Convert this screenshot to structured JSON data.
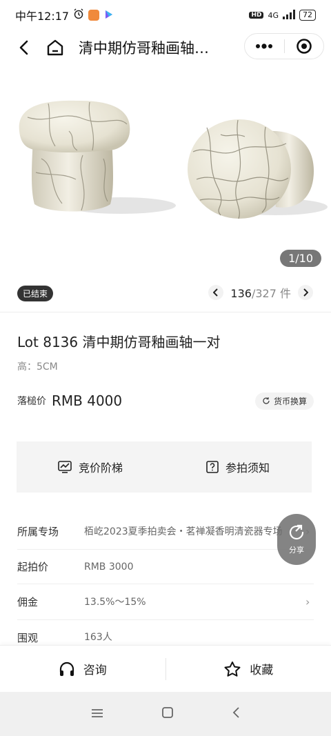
{
  "status_bar": {
    "time": "中午12:17",
    "hd": "HD",
    "network": "4G",
    "battery": "72"
  },
  "nav": {
    "title": "清中期仿哥釉画轴…"
  },
  "gallery": {
    "counter": "1/10"
  },
  "lot_status": {
    "badge": "已结束",
    "current": "136",
    "total": "/327 件"
  },
  "lot": {
    "title": "Lot 8136 清中期仿哥釉画轴一对",
    "dimensions": "高：5CM",
    "hammer_label": "落槌价",
    "hammer_value": "RMB 4000",
    "currency_button": "货币换算"
  },
  "actions": {
    "bid_ladder": "竞价阶梯",
    "auction_notice": "参拍须知"
  },
  "info": [
    {
      "label": "所属专场",
      "value": "栢屹2023夏季拍卖会・茗禅凝香明清瓷器专场"
    },
    {
      "label": "起拍价",
      "value": "RMB 3000"
    },
    {
      "label": "佣金",
      "value": "13.5%～15%"
    },
    {
      "label": "围观",
      "value": "163人"
    }
  ],
  "share": {
    "label": "分享"
  },
  "bottom_bar": {
    "consult": "咨询",
    "favorite": "收藏"
  },
  "colors": {
    "badge_bg": "#333333",
    "fab_bg": "#6e6e6e",
    "action_box_bg": "#f4f4f4"
  }
}
